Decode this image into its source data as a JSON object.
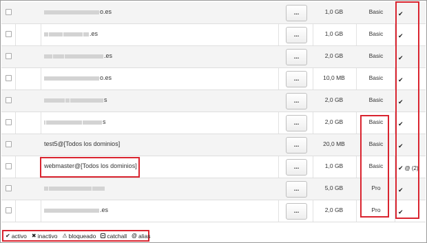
{
  "rows": [
    {
      "email_suffix": "o.es",
      "redact": [
        80
      ],
      "size": "1,0 GB",
      "plan": "Basic",
      "status": "✔",
      "alias": ""
    },
    {
      "email_suffix": ".es",
      "redact": [
        6,
        20,
        28,
        8
      ],
      "size": "1,0 GB",
      "plan": "Basic",
      "status": "✔",
      "alias": ""
    },
    {
      "email_suffix": ".es",
      "redact": [
        12,
        16,
        56
      ],
      "size": "2,0 GB",
      "plan": "Basic",
      "status": "✔",
      "alias": ""
    },
    {
      "email_suffix": "o.es",
      "redact": [
        80
      ],
      "size": "10,0 MB",
      "plan": "Basic",
      "status": "✔",
      "alias": ""
    },
    {
      "email_suffix": "s",
      "redact": [
        30,
        6,
        48
      ],
      "size": "2,0 GB",
      "plan": "Basic",
      "status": "✔",
      "alias": ""
    },
    {
      "email_suffix": "s",
      "redact": [
        2,
        52,
        28
      ],
      "size": "2,0 GB",
      "plan": "Basic",
      "status": "✔",
      "alias": ""
    },
    {
      "email_suffix": "test5@[Todos los dominios]",
      "redact": [],
      "size": "20,0 MB",
      "plan": "Basic",
      "status": "✔",
      "alias": ""
    },
    {
      "email_suffix": "webmaster@[Todos los dominios]",
      "redact": [],
      "size": "1,0 GB",
      "plan": "Basic",
      "status": "✔",
      "alias": "@ (2)"
    },
    {
      "email_suffix": "",
      "redact": [
        6,
        62,
        18
      ],
      "size": "5,0 GB",
      "plan": "Pro",
      "status": "✔",
      "alias": ""
    },
    {
      "email_suffix": ".es",
      "redact": [
        80
      ],
      "size": "2,0 GB",
      "plan": "Pro",
      "status": "✔",
      "alias": ""
    }
  ],
  "actions_button_label": "...",
  "legend": {
    "activo_icon": "✔",
    "activo": "activo",
    "inactivo_icon": "✖",
    "inactivo": "inactivo",
    "bloqueado_icon": "⚠",
    "bloqueado": "bloqueado",
    "catchall": "catchall",
    "alias_icon": "@",
    "alias": "alias"
  },
  "highlight_color": "#d9232e"
}
